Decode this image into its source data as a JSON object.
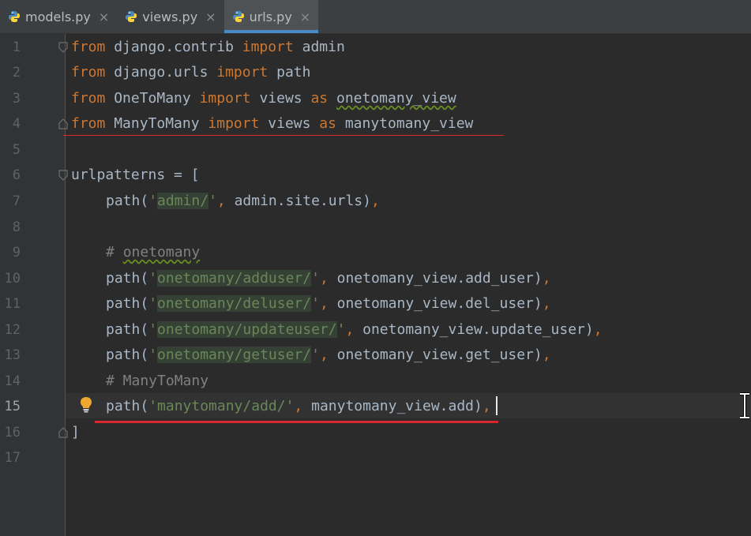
{
  "tabs": [
    {
      "label": "models.py",
      "active": false
    },
    {
      "label": "views.py",
      "active": false
    },
    {
      "label": "urls.py",
      "active": true
    }
  ],
  "close_glyph": "×",
  "current_line": 15,
  "lines": [
    {
      "n": "1"
    },
    {
      "n": "2"
    },
    {
      "n": "3"
    },
    {
      "n": "4"
    },
    {
      "n": "5"
    },
    {
      "n": "6"
    },
    {
      "n": "7"
    },
    {
      "n": "8"
    },
    {
      "n": "9"
    },
    {
      "n": "10"
    },
    {
      "n": "11"
    },
    {
      "n": "12"
    },
    {
      "n": "13"
    },
    {
      "n": "14"
    },
    {
      "n": "15"
    },
    {
      "n": "16"
    },
    {
      "n": "17"
    }
  ],
  "code": {
    "l1": {
      "from": "from",
      "mod": " django.contrib ",
      "imp": "import",
      "rest": " admin"
    },
    "l2": {
      "from": "from",
      "mod": " django.urls ",
      "imp": "import",
      "rest": " path"
    },
    "l3": {
      "from": "from",
      "mod": " OneToMany ",
      "imp": "import",
      "mid": " views ",
      "as": "as",
      "sp": " ",
      "alias": "onetomany_view"
    },
    "l4": {
      "from": "from",
      "mod": " ManyToMany ",
      "imp": "import",
      "mid": " views ",
      "as": "as",
      "alias": " manytomany_view"
    },
    "l6": {
      "name": "urlpatterns",
      "rest": " = ["
    },
    "l7": {
      "a": "path(",
      "q1": "'",
      "s": "admin/",
      "q2": "'",
      "c": ",",
      "b": " admin.site.urls)",
      "c2": ","
    },
    "l9": {
      "hash": "# ",
      "word": "onetomany"
    },
    "l10": {
      "a": "path(",
      "q1": "'",
      "s": "onetomany/adduser/",
      "q2": "'",
      "c": ",",
      "b": " onetomany_view.add_user)",
      "c2": ","
    },
    "l11": {
      "a": "path(",
      "q1": "'",
      "s": "onetomany/deluser/",
      "q2": "'",
      "c": ",",
      "b": " onetomany_view.del_user)",
      "c2": ","
    },
    "l12": {
      "a": "path(",
      "q1": "'",
      "s": "onetomany/updateuser/",
      "q2": "'",
      "c": ",",
      "b": " onetomany_view.update_user)",
      "c2": ","
    },
    "l13": {
      "a": "path(",
      "q1": "'",
      "s": "onetomany/getuser/",
      "q2": "'",
      "c": ",",
      "b": " onetomany_view.get_user)",
      "c2": ","
    },
    "l14": {
      "text": "# ManyToMany"
    },
    "l15": {
      "a": "path(",
      "s": "'manytomany/add/'",
      "c": ",",
      "b": " manytomany_view.add)",
      "c2": ","
    },
    "l16": {
      "text": "]"
    }
  },
  "colors": {
    "keyword": "#cc7832",
    "string": "#6a8759",
    "comment": "#808080",
    "text": "#a9b7c6",
    "annotation_underline": "#d9272e",
    "tab_active_indicator": "#4a88c7"
  },
  "icons": {
    "tab_file": "python-file-icon",
    "intention": "lightbulb-icon",
    "cursor": "text-ibeam-icon",
    "fold": "fold-marker-icon"
  }
}
